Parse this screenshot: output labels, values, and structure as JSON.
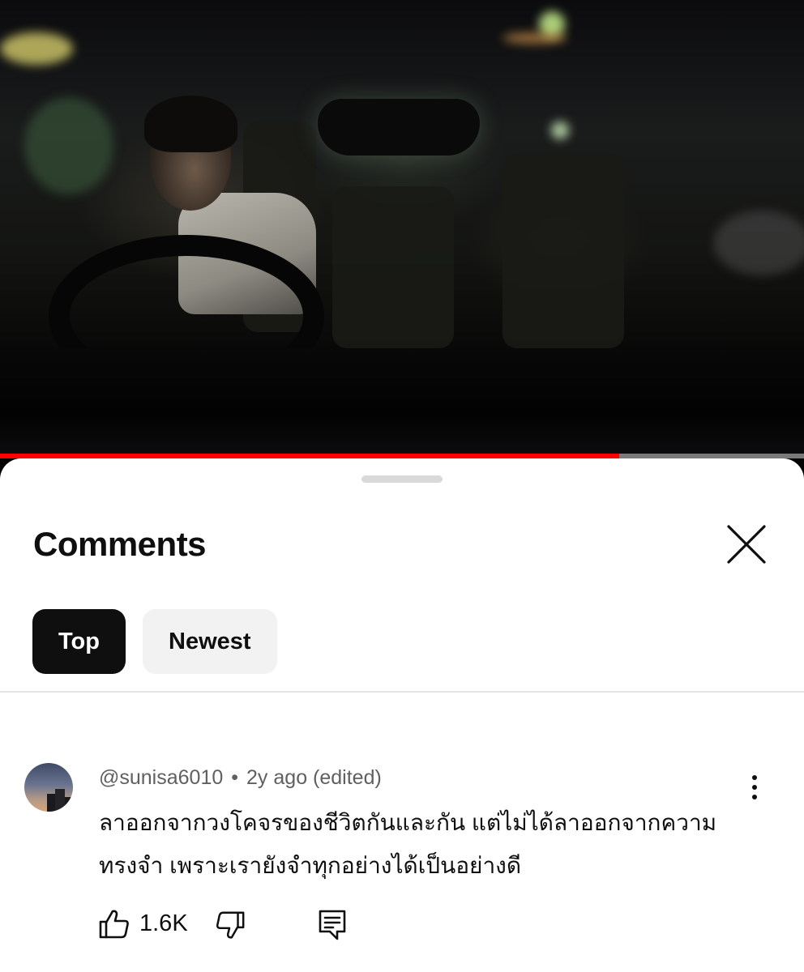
{
  "video": {
    "progress_fraction": 0.77,
    "progress_color": "#ff0000"
  },
  "comments_panel": {
    "title": "Comments",
    "close_icon": "close-icon",
    "sort_chips": [
      {
        "label": "Top",
        "selected": true
      },
      {
        "label": "Newest",
        "selected": false
      }
    ]
  },
  "comment": {
    "author": "@sunisa6010",
    "separator": "•",
    "age": "2y ago",
    "edited": "(edited)",
    "text": "ลาออกจากวงโคจรของชีวิตกันและกัน แต่ไม่ได้ลาออกจากความทรงจำ เพราะเรายังจำทุกอย่างได้เป็นอย่างดี",
    "like_count": "1.6K",
    "icons": {
      "menu": "more-vert-icon",
      "like": "thumbs-up-icon",
      "dislike": "thumbs-down-icon",
      "reply": "reply-icon"
    }
  }
}
